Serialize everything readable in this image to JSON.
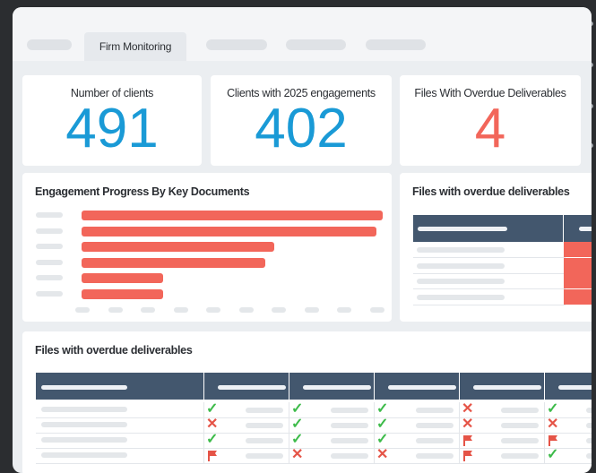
{
  "tabs": {
    "active_label": "Firm Monitoring"
  },
  "kpis": [
    {
      "title": "Number of clients",
      "value": "491",
      "color": "#1a9ad6"
    },
    {
      "title": "Clients with 2025 engagements",
      "value": "402",
      "color": "#1a9ad6"
    },
    {
      "title": "Files With Overdue Deliverables",
      "value": "4",
      "color": "#f2665a"
    }
  ],
  "engagement_progress": {
    "title": "Engagement Progress By Key Documents",
    "bar_values": [
      100,
      98,
      64,
      61,
      27,
      27
    ]
  },
  "overdue_small": {
    "title": "Files with overdue deliverables"
  },
  "overdue_table": {
    "title": "Files with overdue deliverables",
    "rows": [
      [
        "check",
        "check",
        "check",
        "x",
        "check"
      ],
      [
        "x",
        "check",
        "check",
        "x",
        "x"
      ],
      [
        "check",
        "check",
        "check",
        "flag",
        "flag"
      ],
      [
        "flag",
        "x",
        "x",
        "flag",
        "check"
      ]
    ]
  },
  "colors": {
    "accent_blue": "#1a9ad6",
    "alert_red": "#f2665a",
    "header_navy": "#43576e",
    "ok_green": "#3dbb4a"
  }
}
